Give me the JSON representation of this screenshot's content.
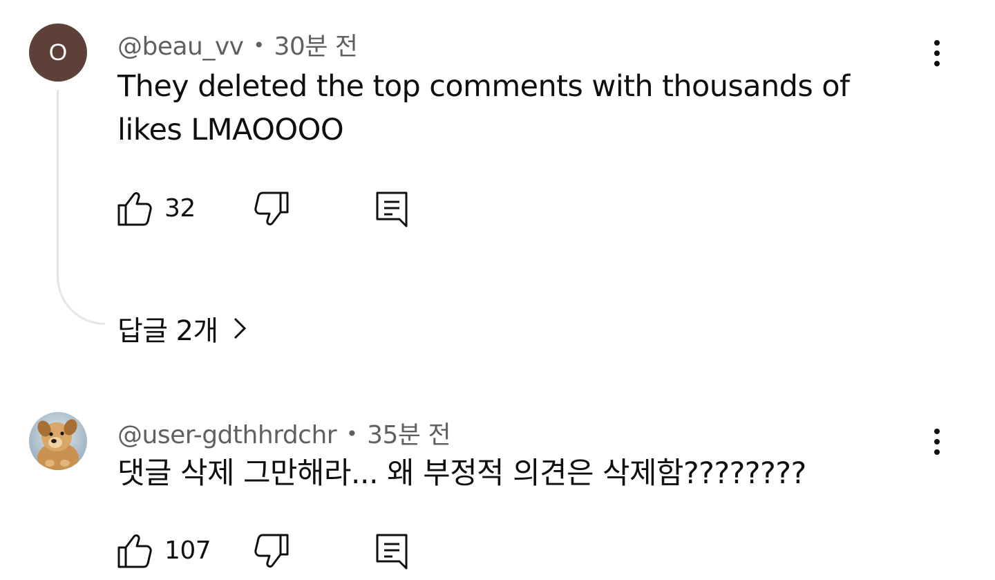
{
  "comments": [
    {
      "avatar_letter": "O",
      "avatar_color": "#5d4037",
      "author": "@beau_vv",
      "separator": "•",
      "time": "30분 전",
      "text": "They deleted the top comments with thousands of likes LMAOOOO",
      "likes": "32",
      "replies_label": "답글 2개"
    },
    {
      "avatar_icon": "puppy-photo",
      "author": "@user-gdthhrdchr",
      "separator": "•",
      "time": "35분 전",
      "text": "댓글 삭제 그만해라...  왜 부정적 의견은 삭제함????????",
      "likes": "107"
    }
  ]
}
